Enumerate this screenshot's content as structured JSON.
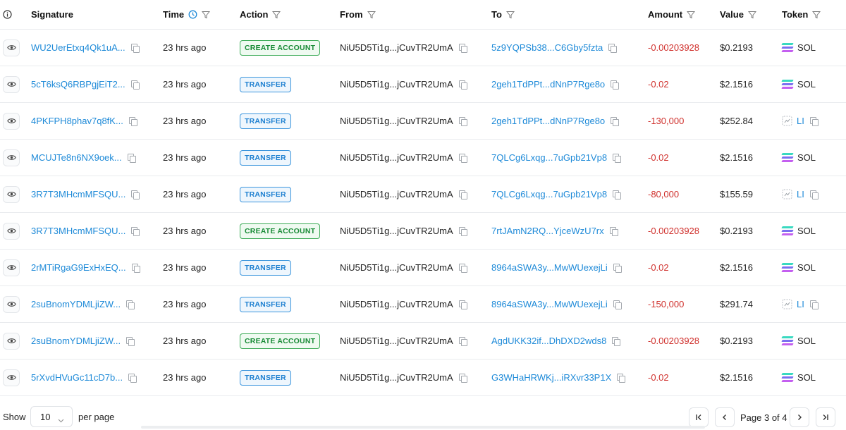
{
  "header": {
    "info_icon": "info-circle-icon",
    "signature": "Signature",
    "time": "Time",
    "action": "Action",
    "from": "From",
    "to": "To",
    "amount": "Amount",
    "value": "Value",
    "token": "Token"
  },
  "rows": [
    {
      "signature": "WU2UerEtxq4Qk1uA...",
      "time": "23 hrs ago",
      "action": "CREATE ACCOUNT",
      "action_type": "create",
      "from": "NiU5D5Ti1g...jCuvTR2UmA",
      "to": "5z9YQPSb38...C6Gby5fzta",
      "amount": "-0.00203928",
      "value": "$0.2193",
      "token": "SOL",
      "token_type": "sol"
    },
    {
      "signature": "5cT6ksQ6RBPgjEiT2...",
      "time": "23 hrs ago",
      "action": "TRANSFER",
      "action_type": "transfer",
      "from": "NiU5D5Ti1g...jCuvTR2UmA",
      "to": "2geh1TdPPt...dNnP7Rge8o",
      "amount": "-0.02",
      "value": "$2.1516",
      "token": "SOL",
      "token_type": "sol"
    },
    {
      "signature": "4PKFPH8phav7q8fK...",
      "time": "23 hrs ago",
      "action": "TRANSFER",
      "action_type": "transfer",
      "from": "NiU5D5Ti1g...jCuvTR2UmA",
      "to": "2geh1TdPPt...dNnP7Rge8o",
      "amount": "-130,000",
      "value": "$252.84",
      "token": "LI",
      "token_type": "li"
    },
    {
      "signature": "MCUJTe8n6NX9oek...",
      "time": "23 hrs ago",
      "action": "TRANSFER",
      "action_type": "transfer",
      "from": "NiU5D5Ti1g...jCuvTR2UmA",
      "to": "7QLCg6Lxqg...7uGpb21Vp8",
      "amount": "-0.02",
      "value": "$2.1516",
      "token": "SOL",
      "token_type": "sol"
    },
    {
      "signature": "3R7T3MHcmMFSQU...",
      "time": "23 hrs ago",
      "action": "TRANSFER",
      "action_type": "transfer",
      "from": "NiU5D5Ti1g...jCuvTR2UmA",
      "to": "7QLCg6Lxqg...7uGpb21Vp8",
      "amount": "-80,000",
      "value": "$155.59",
      "token": "LI",
      "token_type": "li"
    },
    {
      "signature": "3R7T3MHcmMFSQU...",
      "time": "23 hrs ago",
      "action": "CREATE ACCOUNT",
      "action_type": "create",
      "from": "NiU5D5Ti1g...jCuvTR2UmA",
      "to": "7rtJAmN2RQ...YjceWzU7rx",
      "amount": "-0.00203928",
      "value": "$0.2193",
      "token": "SOL",
      "token_type": "sol"
    },
    {
      "signature": "2rMTiRgaG9ExHxEQ...",
      "time": "23 hrs ago",
      "action": "TRANSFER",
      "action_type": "transfer",
      "from": "NiU5D5Ti1g...jCuvTR2UmA",
      "to": "8964aSWA3y...MwWUexejLi",
      "amount": "-0.02",
      "value": "$2.1516",
      "token": "SOL",
      "token_type": "sol"
    },
    {
      "signature": "2suBnomYDMLjiZW...",
      "time": "23 hrs ago",
      "action": "TRANSFER",
      "action_type": "transfer",
      "from": "NiU5D5Ti1g...jCuvTR2UmA",
      "to": "8964aSWA3y...MwWUexejLi",
      "amount": "-150,000",
      "value": "$291.74",
      "token": "LI",
      "token_type": "li"
    },
    {
      "signature": "2suBnomYDMLjiZW...",
      "time": "23 hrs ago",
      "action": "CREATE ACCOUNT",
      "action_type": "create",
      "from": "NiU5D5Ti1g...jCuvTR2UmA",
      "to": "AgdUKK32if...DhDXD2wds8",
      "amount": "-0.00203928",
      "value": "$0.2193",
      "token": "SOL",
      "token_type": "sol"
    },
    {
      "signature": "5rXvdHVuGc11cD7b...",
      "time": "23 hrs ago",
      "action": "TRANSFER",
      "action_type": "transfer",
      "from": "NiU5D5Ti1g...jCuvTR2UmA",
      "to": "G3WHaHRWKj...iRXvr33P1X",
      "amount": "-0.02",
      "value": "$2.1516",
      "token": "SOL",
      "token_type": "sol"
    }
  ],
  "footer": {
    "show_label": "Show",
    "page_size": "10",
    "per_page_label": "per page",
    "page_label": "Page 3 of 4"
  },
  "colors": {
    "link": "#1e8ad8",
    "negative": "#d0312d",
    "create_badge": "#178a35",
    "transfer_badge": "#1c7fd0"
  }
}
